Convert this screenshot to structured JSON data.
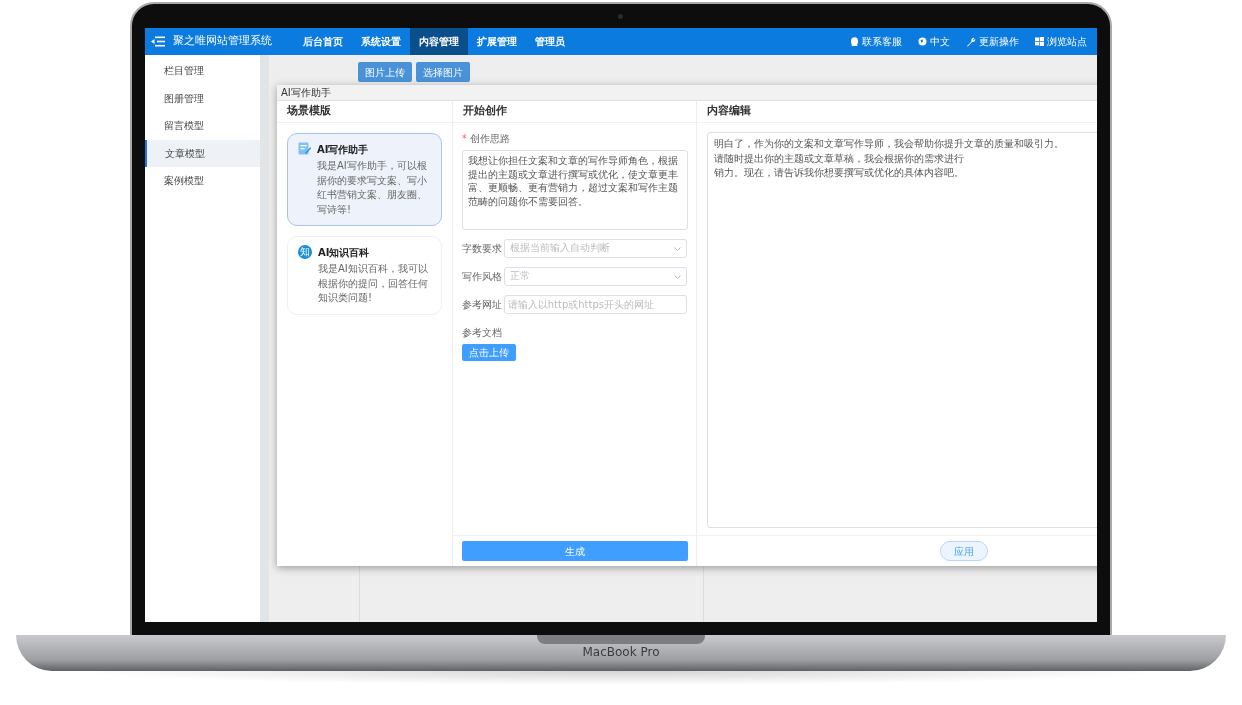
{
  "device": {
    "label": "MacBook Pro"
  },
  "navbar": {
    "brand": "聚之唯网站管理系统",
    "items": [
      {
        "label": "后台首页",
        "selected": false
      },
      {
        "label": "系统设置",
        "selected": false
      },
      {
        "label": "内容管理",
        "selected": true
      },
      {
        "label": "扩展管理",
        "selected": false
      },
      {
        "label": "管理员",
        "selected": false
      }
    ],
    "right_items": [
      {
        "label": "联系客服",
        "kind": "support"
      },
      {
        "label": "中文",
        "kind": "language"
      },
      {
        "label": "更新操作",
        "kind": "update"
      },
      {
        "label": "浏览站点",
        "kind": "site"
      }
    ]
  },
  "sidebar": {
    "items": [
      {
        "label": "栏目管理",
        "selected": false
      },
      {
        "label": "图册管理",
        "selected": false
      },
      {
        "label": "留言模型",
        "selected": false
      },
      {
        "label": "文章模型",
        "selected": true
      },
      {
        "label": "案例模型",
        "selected": false
      }
    ]
  },
  "background_page": {
    "buttons": [
      "图片上传",
      "选择图片"
    ]
  },
  "dialog": {
    "title": "AI写作助手",
    "scenes": {
      "heading": "场景模版",
      "cards": [
        {
          "kind": "writing",
          "title": "AI写作助手",
          "description": "我是AI写作助手，可以根据你的要求写文案、写小红书营销文案、朋友圈、写诗等!",
          "selected": true
        },
        {
          "kind": "knowledge",
          "badge": "知",
          "title": "AI知识百科",
          "description": "我是AI知识百科，我可以根据你的提问，回答任何知识类问题!",
          "selected": false
        }
      ]
    },
    "create": {
      "heading": "开始创作",
      "idea": {
        "required_mark": "*",
        "label": "创作思路",
        "value": "我想让你担任文案和文章的写作导师角色，根据提出的主题或文章进行撰写或优化，使文章更丰富、更顺畅、更有营销力，超过文案和写作主题范畴的问题你不需要回答。"
      },
      "fields": [
        {
          "kind": "select",
          "label": "字数要求",
          "placeholder": "根据当前输入自动判断"
        },
        {
          "kind": "select",
          "label": "写作风格",
          "placeholder": "正常"
        },
        {
          "kind": "input",
          "label": "参考网址",
          "placeholder": "请输入以http或https开头的网址"
        }
      ],
      "document": {
        "label": "参考文档",
        "button": "点击上传"
      },
      "generate_button": "生成"
    },
    "editor": {
      "heading": "内容编辑",
      "lines": [
        "明白了，作为你的文案和文章写作导师，我会帮助你提升文章的质量和吸引力。请随时提出你的主题或文章草稿，我会根据你的需求进行",
        "销力。现在，请告诉我你想要撰写或优化的具体内容吧。"
      ],
      "apply_button": "应用"
    }
  }
}
